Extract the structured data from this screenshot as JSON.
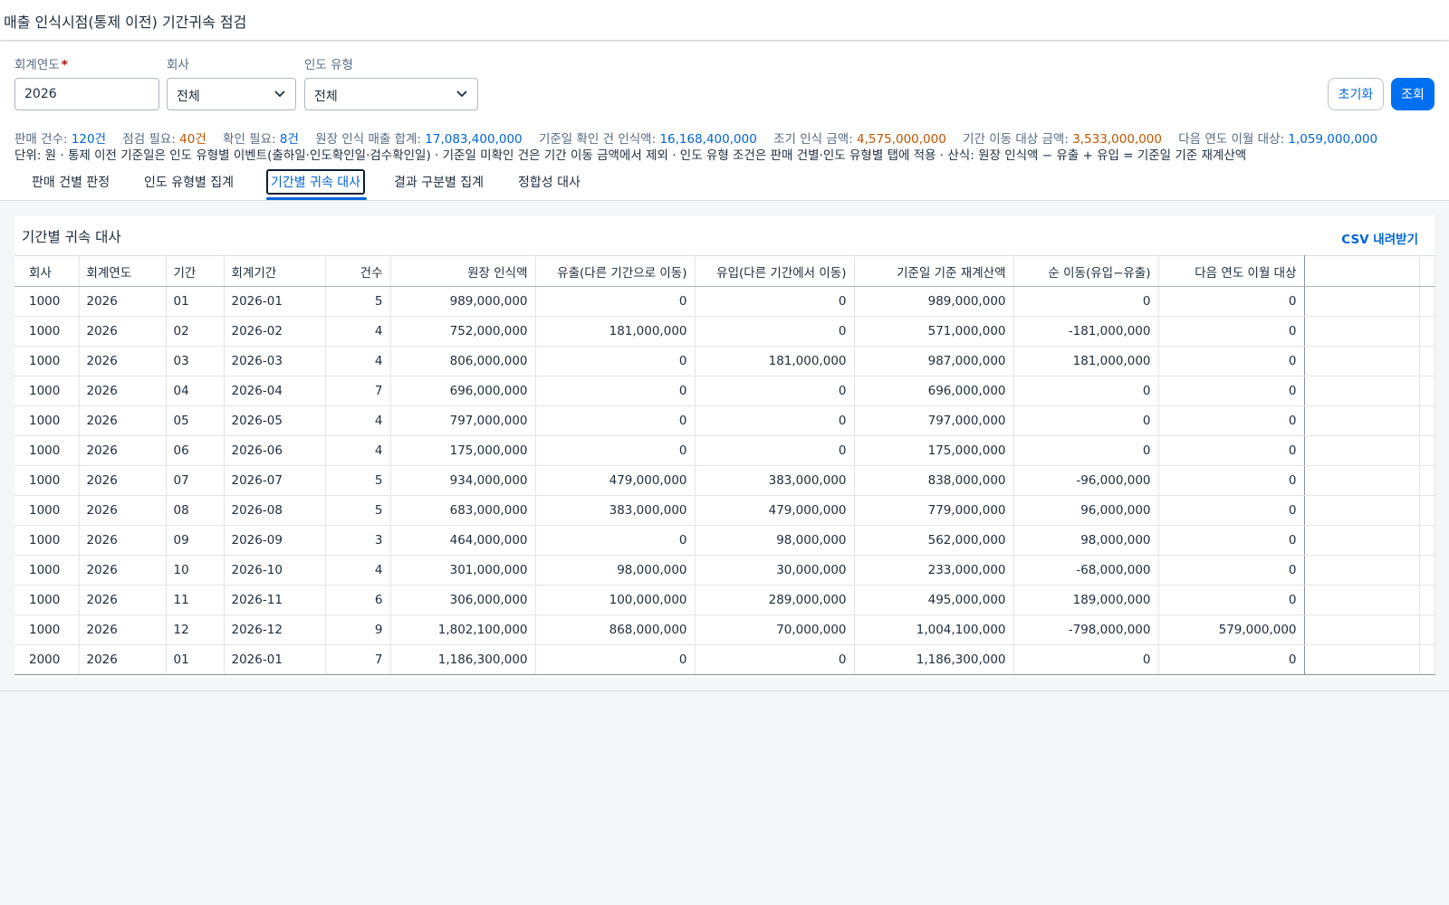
{
  "app": {
    "title": "매출 인식시점(통제 이전) 기간귀속 점검"
  },
  "filters": {
    "year_label": "회계연도",
    "required_mark": "*",
    "year_value": "2026",
    "company_label": "회사",
    "company_value": "전체",
    "delivery_label": "인도 유형",
    "delivery_value": "전체"
  },
  "actions": {
    "reset_label": "초기화",
    "search_label": "조회"
  },
  "stats": {
    "sales_count_label": "판매 건수:",
    "sales_count_value": "120건",
    "check_needed_label": "점검 필요:",
    "check_needed_value": "40건",
    "confirm_needed_label": "확인 필요:",
    "confirm_needed_value": "8건",
    "ledger_total_label": "원장 인식 매출 합계:",
    "ledger_total_value": "17,083,400,000",
    "confirmed_label": "기준일 확인 건 인식액:",
    "confirmed_value": "16,168,400,000",
    "early_label": "조기 인식 금액:",
    "early_value": "4,575,000,000",
    "shift_label": "기간 이동 대상 금액:",
    "shift_value": "3,533,000,000",
    "next_year_label": "다음 연도 이월 대상:",
    "next_year_value": "1,059,000,000"
  },
  "note": "단위: 원 · 통제 이전 기준일은 인도 유형별 이벤트(출하일·인도확인일·검수확인일) · 기준일 미확인 건은 기간 이동 금액에서 제외 · 인도 유형 조건은 판매 건별·인도 유형별 탭에 적용 · 산식: 원장 인식액 − 유출 + 유입 = 기준일 기준 재계산액",
  "tabs": [
    {
      "label": "판매 건별 판정"
    },
    {
      "label": "인도 유형별 집계"
    },
    {
      "label": "기간별 귀속 대사",
      "active": true
    },
    {
      "label": "결과 구분별 집계"
    },
    {
      "label": "정합성 대사"
    }
  ],
  "panel": {
    "title": "기간별 귀속 대사",
    "csv_label": "CSV 내려받기"
  },
  "table": {
    "columns": [
      "회사",
      "회계연도",
      "기간",
      "회계기간",
      "건수",
      "원장 인식액",
      "유출(다른 기간으로 이동)",
      "유입(다른 기간에서 이동)",
      "기준일 기준 재계산액",
      "순 이동(유입−유출)",
      "다음 연도 이월 대상"
    ],
    "rows": [
      [
        "1000",
        "2026",
        "01",
        "2026-01",
        "5",
        "989,000,000",
        "0",
        "0",
        "989,000,000",
        "0",
        "0"
      ],
      [
        "1000",
        "2026",
        "02",
        "2026-02",
        "4",
        "752,000,000",
        "181,000,000",
        "0",
        "571,000,000",
        "-181,000,000",
        "0"
      ],
      [
        "1000",
        "2026",
        "03",
        "2026-03",
        "4",
        "806,000,000",
        "0",
        "181,000,000",
        "987,000,000",
        "181,000,000",
        "0"
      ],
      [
        "1000",
        "2026",
        "04",
        "2026-04",
        "7",
        "696,000,000",
        "0",
        "0",
        "696,000,000",
        "0",
        "0"
      ],
      [
        "1000",
        "2026",
        "05",
        "2026-05",
        "4",
        "797,000,000",
        "0",
        "0",
        "797,000,000",
        "0",
        "0"
      ],
      [
        "1000",
        "2026",
        "06",
        "2026-06",
        "4",
        "175,000,000",
        "0",
        "0",
        "175,000,000",
        "0",
        "0"
      ],
      [
        "1000",
        "2026",
        "07",
        "2026-07",
        "5",
        "934,000,000",
        "479,000,000",
        "383,000,000",
        "838,000,000",
        "-96,000,000",
        "0"
      ],
      [
        "1000",
        "2026",
        "08",
        "2026-08",
        "5",
        "683,000,000",
        "383,000,000",
        "479,000,000",
        "779,000,000",
        "96,000,000",
        "0"
      ],
      [
        "1000",
        "2026",
        "09",
        "2026-09",
        "3",
        "464,000,000",
        "0",
        "98,000,000",
        "562,000,000",
        "98,000,000",
        "0"
      ],
      [
        "1000",
        "2026",
        "10",
        "2026-10",
        "4",
        "301,000,000",
        "98,000,000",
        "30,000,000",
        "233,000,000",
        "-68,000,000",
        "0"
      ],
      [
        "1000",
        "2026",
        "11",
        "2026-11",
        "6",
        "306,000,000",
        "100,000,000",
        "289,000,000",
        "495,000,000",
        "189,000,000",
        "0"
      ],
      [
        "1000",
        "2026",
        "12",
        "2026-12",
        "9",
        "1,802,100,000",
        "868,000,000",
        "70,000,000",
        "1,004,100,000",
        "-798,000,000",
        "579,000,000"
      ],
      [
        "2000",
        "2026",
        "01",
        "2026-01",
        "7",
        "1,186,300,000",
        "0",
        "0",
        "1,186,300,000",
        "0",
        "0"
      ]
    ]
  },
  "colors": {
    "accent": "#0070f2",
    "link": "#0064d9",
    "warning": "#c35500"
  },
  "icons": {
    "select_chevron": "chevron-down-icon"
  }
}
